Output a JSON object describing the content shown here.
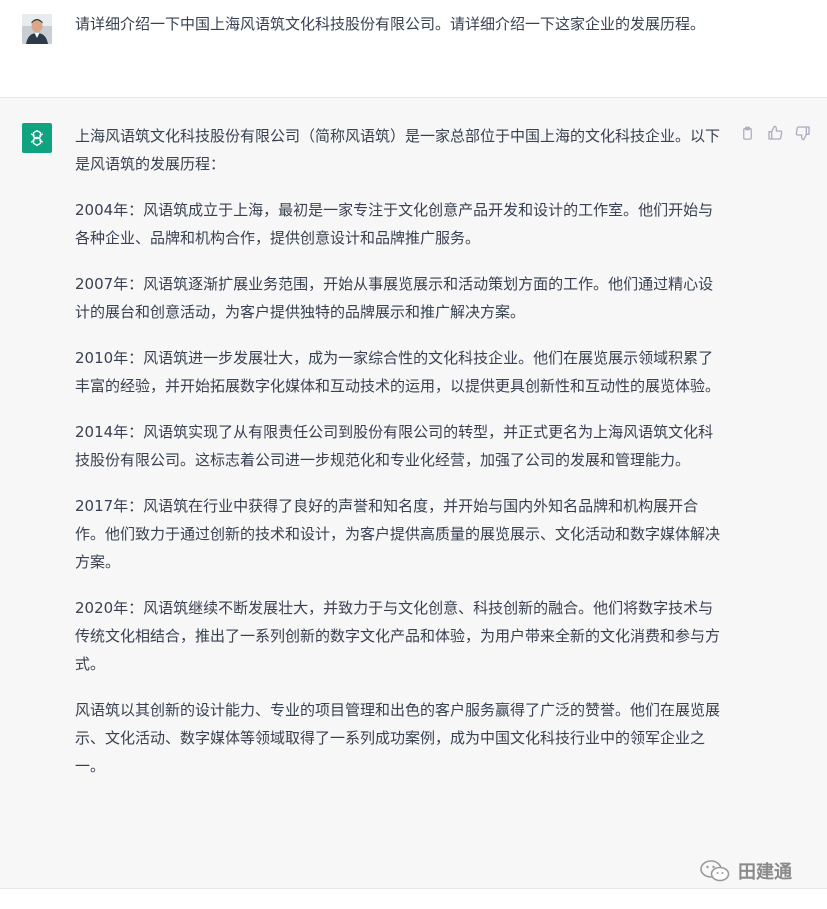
{
  "user_message": {
    "text": "请详细介绍一下中国上海风语筑文化科技股份有限公司。请详细介绍一下这家企业的发展历程。"
  },
  "assistant_message": {
    "paragraphs": [
      "上海风语筑文化科技股份有限公司（简称风语筑）是一家总部位于中国上海的文化科技企业。以下是风语筑的发展历程：",
      "2004年：风语筑成立于上海，最初是一家专注于文化创意产品开发和设计的工作室。他们开始与各种企业、品牌和机构合作，提供创意设计和品牌推广服务。",
      "2007年：风语筑逐渐扩展业务范围，开始从事展览展示和活动策划方面的工作。他们通过精心设计的展台和创意活动，为客户提供独特的品牌展示和推广解决方案。",
      "2010年：风语筑进一步发展壮大，成为一家综合性的文化科技企业。他们在展览展示领域积累了丰富的经验，并开始拓展数字化媒体和互动技术的运用，以提供更具创新性和互动性的展览体验。",
      "2014年：风语筑实现了从有限责任公司到股份有限公司的转型，并正式更名为上海风语筑文化科技股份有限公司。这标志着公司进一步规范化和专业化经营，加强了公司的发展和管理能力。",
      "2017年：风语筑在行业中获得了良好的声誉和知名度，并开始与国内外知名品牌和机构展开合作。他们致力于通过创新的技术和设计，为客户提供高质量的展览展示、文化活动和数字媒体解决方案。",
      "2020年：风语筑继续不断发展壮大，并致力于与文化创意、科技创新的融合。他们将数字技术与传统文化相结合，推出了一系列创新的数字文化产品和体验，为用户带来全新的文化消费和参与方式。",
      "风语筑以其创新的设计能力、专业的项目管理和出色的客户服务赢得了广泛的赞誉。他们在展览展示、文化活动、数字媒体等领域取得了一系列成功案例，成为中国文化科技行业中的领军企业之一。"
    ]
  },
  "actions": [
    "copy-icon",
    "thumbs-up-icon",
    "thumbs-down-icon"
  ],
  "watermark": {
    "text": "田建通"
  },
  "colors": {
    "assistant_bg": "#f7f7f8",
    "gpt_green": "#10a37f",
    "text": "#374151"
  }
}
